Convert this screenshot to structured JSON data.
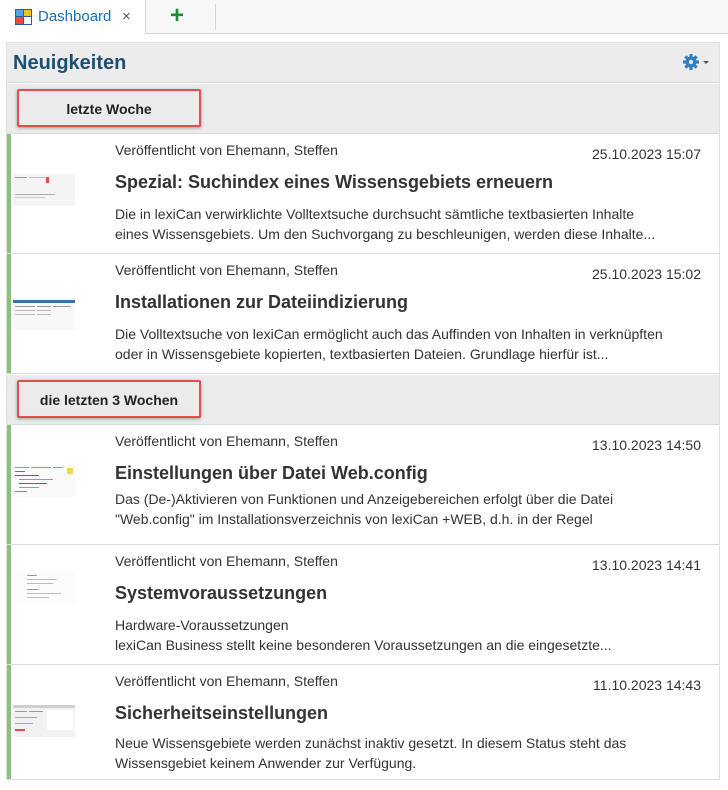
{
  "tab": {
    "label": "Dashboard",
    "close": "×",
    "add": "+"
  },
  "panel": {
    "title": "Neuigkeiten"
  },
  "groups": [
    {
      "label": "letzte Woche"
    },
    {
      "label": "die letzten 3 Wochen"
    }
  ],
  "items": [
    {
      "author": "Veröffentlicht von Ehemann, Steffen",
      "date": "25.10.2023 15:07",
      "title": "Spezial: Suchindex eines Wissensgebiets erneuern",
      "desc1": "Die in lexiCan verwirklichte Volltextsuche durchsucht sämtliche textbasierten Inhalte",
      "desc2": "eines Wissensgebiets. Um den Suchvorgang zu beschleunigen, werden diese Inhalte..."
    },
    {
      "author": "Veröffentlicht von Ehemann, Steffen",
      "date": "25.10.2023 15:02",
      "title": "Installationen zur Dateiindizierung",
      "desc1": "Die Volltextsuche von lexiCan ermöglicht auch das Auffinden von Inhalten in verknüpften",
      "desc2": "oder in Wissensgebiete kopierten, textbasierten Dateien. Grundlage hierfür ist..."
    },
    {
      "author": "Veröffentlicht von Ehemann, Steffen",
      "date": "13.10.2023 14:50",
      "title": "Einstellungen über Datei Web.config",
      "desc1": "Das (De-)Aktivieren von Funktionen und Anzeigebereichen erfolgt über die Datei",
      "desc2": "\"Web.config\" im Installationsverzeichnis von lexiCan +WEB, d.h. in der Regel"
    },
    {
      "author": "Veröffentlicht von Ehemann, Steffen",
      "date": "13.10.2023 14:41",
      "title": "Systemvoraussetzungen",
      "desc1": "Hardware-Voraussetzungen",
      "desc2": "lexiCan Business stellt keine besonderen Voraussetzungen an die eingesetzte..."
    },
    {
      "author": "Veröffentlicht von Ehemann, Steffen",
      "date": "11.10.2023 14:43",
      "title": "Sicherheitseinstellungen",
      "desc1": "Neue Wissensgebiete werden zunächst inaktiv gesetzt. In diesem Status steht das",
      "desc2": "Wissensgebiet keinem Anwender zur Verfügung."
    }
  ],
  "colors": {
    "accent_bar": "#8cc07c",
    "title": "#1d4f73",
    "group_highlight": "#e04e4e",
    "tab_text": "#1a6fb5"
  },
  "icons": {
    "tab": "dashboard-icon",
    "settings": "gear-icon"
  }
}
